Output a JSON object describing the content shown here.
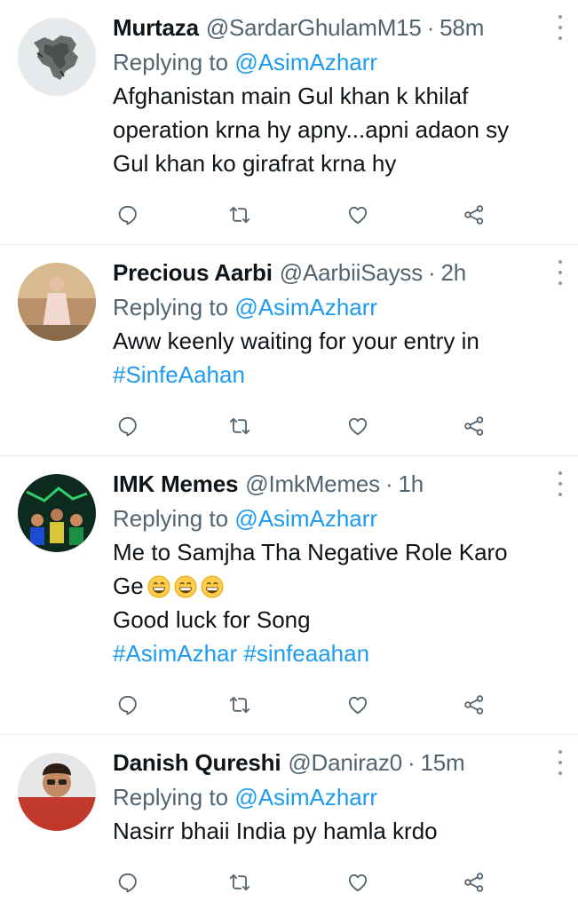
{
  "colors": {
    "link": "#1d9bf0",
    "secondary": "#536471",
    "text": "#0f1419",
    "divider": "#e6ecf0"
  },
  "tweets": [
    {
      "name": "Murtaza",
      "handle": "@SardarGhulamM15",
      "separator": "·",
      "time": "58m",
      "replying_prefix": "Replying to",
      "replying_to": "@AsimAzharr",
      "lines": [
        "Afghanistan main Gul khan k khilaf",
        "operation krna hy apny...apni adaon sy",
        "Gul khan ko girafrat krna hy"
      ],
      "avatar_icon": "map-avatar"
    },
    {
      "name": "Precious Aarbi",
      "handle": "@AarbiiSayss",
      "separator": "·",
      "time": "2h",
      "replying_prefix": "Replying to",
      "replying_to": "@AsimAzharr",
      "lines": [
        "Aww keenly waiting for your entry in"
      ],
      "hashtags": "#SinfeAahan",
      "avatar_icon": "person-avatar"
    },
    {
      "name": "IMK Memes",
      "handle": "@ImkMemes",
      "separator": "·",
      "time": "1h",
      "replying_prefix": "Replying to",
      "replying_to": "@AsimAzharr",
      "lines": [
        "Me to Samjha Tha Negative Role Karo",
        "Ge",
        "Good luck for Song"
      ],
      "hashtags": "#AsimAzhar #sinfeaahan",
      "emoji": "grinning-face-emoji",
      "avatar_icon": "team-avatar"
    },
    {
      "name": "Danish Qureshi",
      "handle": "@Daniraz0",
      "separator": "·",
      "time": "15m",
      "replying_prefix": "Replying to",
      "replying_to": "@AsimAzharr",
      "lines": [
        "Nasirr bhaii India py hamla krdo"
      ],
      "avatar_icon": "person-avatar"
    }
  ],
  "action_icons": [
    "reply-icon",
    "retweet-icon",
    "like-icon",
    "share-icon"
  ]
}
